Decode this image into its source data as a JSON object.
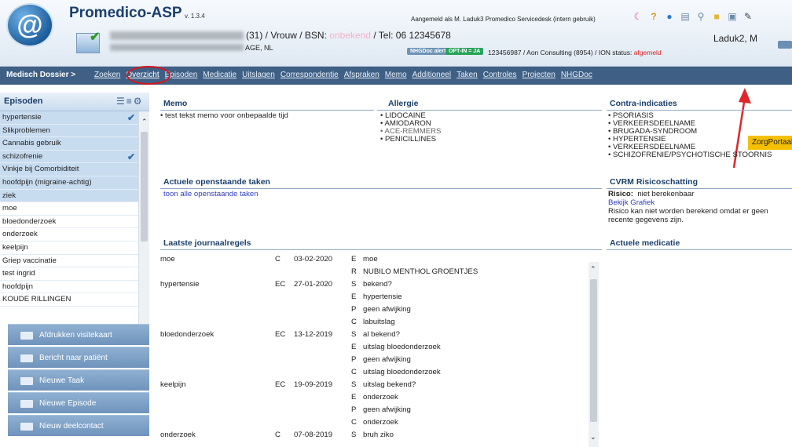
{
  "app": {
    "title": "Promedico-ASP",
    "version": "v. 1.3.4"
  },
  "header": {
    "logged_in": "Aangemeld als M. Laduk3  Promedico Servicedesk (intern gebruik)",
    "patient_line": "(31) / Vrouw / BSN: ",
    "bsn": "onbekend",
    "tel": " / Tel: 06 12345678",
    "address_tail": "AGE, NL",
    "user_short": "Laduk2, M",
    "nhg_alert": "NHGDoc alert",
    "opt_in": "OPT-IN = JA",
    "aon_line": "123456987 / Aon Consulting (8954) / ION status: ",
    "ion_status": "afgemeld"
  },
  "nav": {
    "dossier": "Medisch Dossier >",
    "items": [
      "Zoeken",
      "Overzicht",
      "Episoden",
      "Medicatie",
      "Uitslagen",
      "Correspondentie",
      "Afspraken",
      "Memo",
      "Additioneel",
      "Taken",
      "Controles",
      "Projecten",
      "NHGDoc"
    ],
    "zorgportaal": "ZorgPortaal"
  },
  "sidebar": {
    "title": "Episoden",
    "episodes": [
      "hypertensie",
      "Slikproblemen",
      "Cannabis gebruik",
      "schizofrenie",
      "Vinkje bij Comorbiditeit",
      "hoofdpijn (migraine-achtig)",
      "ziek",
      "moe",
      "bloedonderzoek",
      "onderzoek",
      "keelpijn",
      "Griep vaccinatie",
      "test ingrid",
      "hoofdpijn",
      "KOUDE RILLINGEN"
    ],
    "buttons": [
      "Afdrukken visitekaart",
      "Bericht naar patiënt",
      "Nieuwe Taak",
      "Nieuwe Episode",
      "Nieuw deelcontact"
    ]
  },
  "memo": {
    "title": "Memo",
    "text": "• test tekst memo voor onbepaalde tijd"
  },
  "allergie": {
    "title": "Allergie",
    "items": [
      "• LIDOCAINE",
      "• AMIODARON",
      "• ACE-REMMERS",
      "• PENICILLINES"
    ]
  },
  "contra": {
    "title": "Contra-indicaties",
    "items": [
      "• PSORIASIS",
      "• VERKEERSDEELNAME",
      "• BRUGADA-SYNDROOM",
      "• HYPERTENSIE",
      "• VERKEERSDEELNAME",
      "• SCHIZOFRENIE/PSYCHOTISCHE STOORNIS"
    ]
  },
  "taken": {
    "title": "Actuele openstaande taken",
    "link": "toon alle openstaande taken"
  },
  "cvrm": {
    "title": "CVRM Risicoschatting",
    "risico_label": "Risico:",
    "risico_value": "niet berekenbaar",
    "link": "Bekijk Grafiek",
    "note1": "Risico kan niet worden berekend omdat er geen",
    "note2": "recente gegevens zijn."
  },
  "medicatie": {
    "title": "Actuele medicatie"
  },
  "journal": {
    "title": "Laatste journaalregels",
    "rows": [
      {
        "ep": "moe",
        "code": "C",
        "date": "03-02-2020",
        "s": "E",
        "text": "moe"
      },
      {
        "ep": "",
        "code": "",
        "date": "",
        "s": "R",
        "text": "NUBILO MENTHOL GROENTJES"
      },
      {
        "ep": "hypertensie",
        "code": "EC",
        "date": "27-01-2020",
        "s": "S",
        "text": "bekend?"
      },
      {
        "ep": "",
        "code": "",
        "date": "",
        "s": "E",
        "text": "hypertensie"
      },
      {
        "ep": "",
        "code": "",
        "date": "",
        "s": "P",
        "text": "geen afwijking"
      },
      {
        "ep": "",
        "code": "",
        "date": "",
        "s": "C",
        "text": "labuitslag"
      },
      {
        "ep": "bloedonderzoek",
        "code": "EC",
        "date": "13-12-2019",
        "s": "S",
        "text": "al bekend?"
      },
      {
        "ep": "",
        "code": "",
        "date": "",
        "s": "E",
        "text": "uitslag bloedonderzoek"
      },
      {
        "ep": "",
        "code": "",
        "date": "",
        "s": "P",
        "text": "geen afwijking"
      },
      {
        "ep": "",
        "code": "",
        "date": "",
        "s": "C",
        "text": "uitslag bloedonderzoek"
      },
      {
        "ep": "keelpijn",
        "code": "EC",
        "date": "19-09-2019",
        "s": "S",
        "text": "uitslag bekend?"
      },
      {
        "ep": "",
        "code": "",
        "date": "",
        "s": "E",
        "text": "onderzoek"
      },
      {
        "ep": "",
        "code": "",
        "date": "",
        "s": "P",
        "text": "geen afwijking"
      },
      {
        "ep": "",
        "code": "",
        "date": "",
        "s": "C",
        "text": "onderzoek"
      },
      {
        "ep": "onderzoek",
        "code": "C",
        "date": "07-08-2019",
        "s": "S",
        "text": "bruh ziko"
      }
    ]
  },
  "colors": {
    "nav_bg": "#3f5f85",
    "zorg_btn": "#f5c000",
    "highlight": "#c8dcf0",
    "annotation_red": "#d8141a"
  }
}
